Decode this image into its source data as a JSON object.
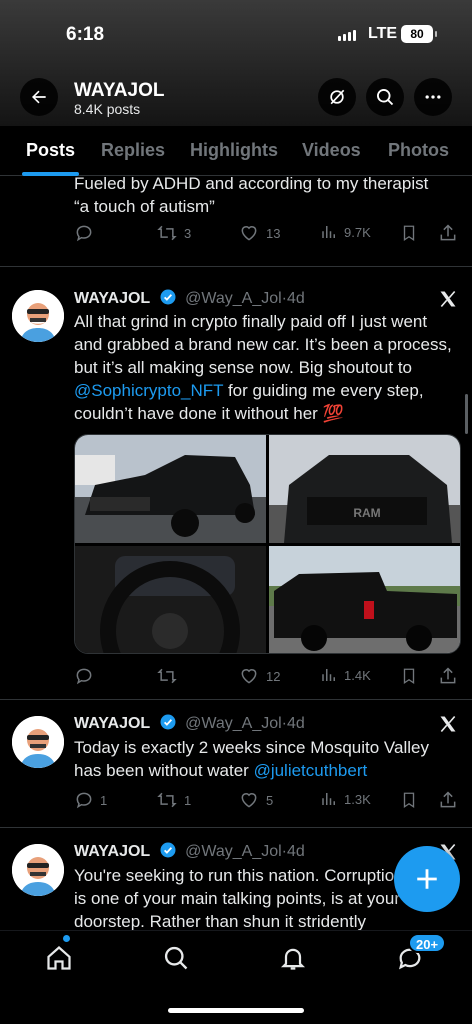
{
  "status_bar": {
    "time": "6:18",
    "network": "LTE",
    "battery": "80"
  },
  "header": {
    "title": "WAYAJOL",
    "subtitle": "8.4K posts"
  },
  "tabs": [
    {
      "label": "Posts"
    },
    {
      "label": "Replies"
    },
    {
      "label": "Highlights"
    },
    {
      "label": "Videos"
    },
    {
      "label": "Photos"
    }
  ],
  "posts": [
    {
      "text_lines": [
        "Fueled by ADHD and according to my therapist",
        "“a touch of autism”"
      ],
      "replies": "",
      "reposts": "3",
      "likes": "13",
      "views": "9.7K"
    },
    {
      "name": "WAYAJOL",
      "handle": "@Way_A_Jol",
      "time": "4d",
      "text_a": "All that grind in crypto finally paid off I just went and grabbed a brand new car. It’s been a process, but it’s all making sense now. Big shoutout to ",
      "mention": "@Sophicrypto_NFT",
      "text_b": " for guiding me every step, couldn’t have done it without her 💯",
      "replies": "",
      "reposts": "",
      "likes": "12",
      "views": "1.4K"
    },
    {
      "name": "WAYAJOL",
      "handle": "@Way_A_Jol",
      "time": "4d",
      "text_a": "Today is exactly 2 weeks since Mosquito Valley has been without water ",
      "mention": "@julietcuthbert",
      "replies": "1",
      "reposts": "1",
      "likes": "5",
      "views": "1.3K"
    },
    {
      "name": "WAYAJOL",
      "handle": "@Way_A_Jol",
      "time": "4d",
      "text_a": "You're seeking to run this nation. Corruption, which is one of your main talking points, is at your doorstep. Rather than shun it stridently"
    }
  ],
  "bottom_nav": {
    "notification_badge": "20+"
  },
  "colors": {
    "accent": "#1d9bf0",
    "background": "#000000",
    "muted": "#71767b"
  }
}
